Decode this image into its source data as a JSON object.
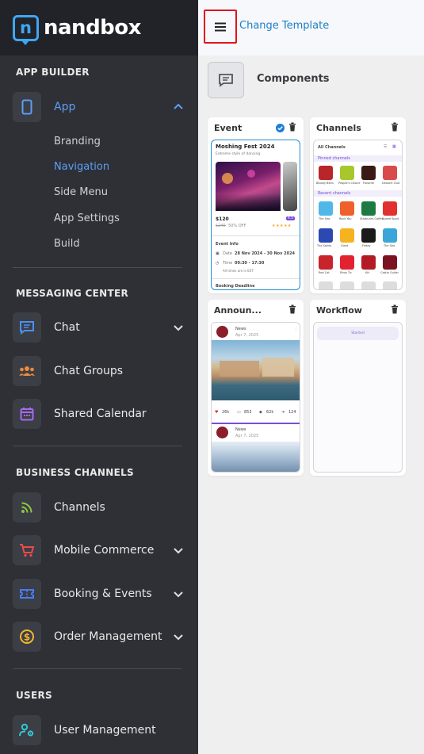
{
  "logo": {
    "text": "nandbox",
    "icon_letter": "n"
  },
  "topbar": {
    "menu_icon": "hamburger-icon",
    "change_template": "Change Template"
  },
  "sidebar": {
    "app_builder": {
      "title": "APP BUILDER",
      "app": {
        "label": "App",
        "icon": "phone-icon",
        "expanded": true
      },
      "sub_items": [
        "Branding",
        "Navigation",
        "Side Menu",
        "App Settings",
        "Build"
      ],
      "active_sub": "Navigation"
    },
    "messaging": {
      "title": "MESSAGING CENTER",
      "items": [
        {
          "label": "Chat",
          "icon": "chat-icon",
          "chevron": true
        },
        {
          "label": "Chat Groups",
          "icon": "group-icon",
          "chevron": false
        },
        {
          "label": "Shared Calendar",
          "icon": "calendar-icon",
          "chevron": false
        }
      ]
    },
    "business": {
      "title": "BUSINESS CHANNELS",
      "items": [
        {
          "label": "Channels",
          "icon": "rss-icon",
          "chevron": false
        },
        {
          "label": "Mobile Commerce",
          "icon": "cart-icon",
          "chevron": true
        },
        {
          "label": "Booking & Events",
          "icon": "ticket-icon",
          "chevron": true
        },
        {
          "label": "Order Management",
          "icon": "dollar-icon",
          "chevron": true
        }
      ]
    },
    "users": {
      "title": "USERS",
      "items": [
        {
          "label": "User Management",
          "icon": "user-gear-icon"
        }
      ]
    }
  },
  "main": {
    "components_title": "Components",
    "cards": [
      {
        "title": "Event",
        "selected": true
      },
      {
        "title": "Channels",
        "selected": false
      },
      {
        "title": "Announ...",
        "selected": false
      },
      {
        "title": "Workflow",
        "selected": false
      }
    ],
    "event_preview": {
      "name": "Moshing Fest 2024",
      "subtitle": "Extreme style of dancing",
      "price": "$120",
      "old_price": "$240",
      "discount": "50% OFF",
      "rating_badge": "4.5",
      "section": "Event Info",
      "date_label": "Date",
      "date_value": "28 Nov 2024 - 30 Nov 2024",
      "time_label": "Time",
      "time_value": "09:30 - 17:30",
      "timezone": "All times are in EET",
      "footer": "Booking Deadline"
    },
    "channels_preview": {
      "header": "All Channels",
      "pinned_label": "Pinned channels",
      "pinned": [
        "Bloody Bites",
        "People's Choice",
        "Favorite",
        "Dessert Club"
      ],
      "recent_label": "Recent channels",
      "recent": [
        "The Sea",
        "Rock You",
        "Starbucks Coffee",
        "Speed Sport",
        "The Saints",
        "Giant",
        "Friday",
        "The Sea",
        "Red Cat",
        "Pizza Tic",
        "Kfc",
        "Castle Guitar"
      ]
    },
    "announcement_preview": {
      "source": "News",
      "date": "Apr 7, 2025",
      "likes": "26k",
      "comments": "853",
      "views": "62k",
      "shares": "124",
      "source2": "News",
      "date2": "Apr 7, 2025"
    },
    "workflow_preview": {
      "button": "Started"
    }
  },
  "colors": {
    "sidebar_bg": "#2e3036",
    "accent_blue": "#5d9ef5",
    "link_blue": "#1c80c7",
    "highlight_red": "#e0161d"
  }
}
